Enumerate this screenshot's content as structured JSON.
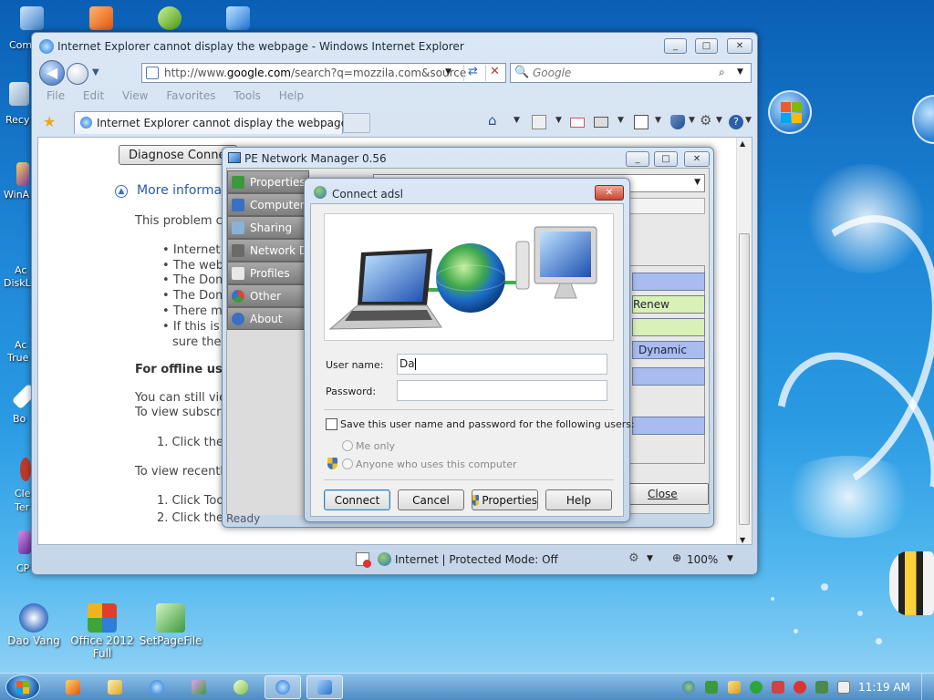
{
  "desktop": {
    "icons_bottom": [
      {
        "label": "Dao Vang"
      },
      {
        "label": "Office 2012 Full"
      },
      {
        "label": "SetPageFile"
      }
    ],
    "edge_labels": [
      "Com",
      "Recy",
      "WinA",
      "Ac",
      "DiskL",
      "Ac",
      "True",
      "Bo",
      "Cle",
      "Ter",
      "CP"
    ]
  },
  "ie": {
    "title": "Internet Explorer cannot display the webpage - Windows Internet Explorer",
    "address_prefix": "http://www.",
    "address_domain": "google.com",
    "address_rest": "/search?q=mozzila.com&source",
    "search_placeholder": "Google",
    "menu": [
      "File",
      "Edit",
      "View",
      "Favorites",
      "Tools",
      "Help"
    ],
    "tab_title": "Internet Explorer cannot display the webpage",
    "content": {
      "diagnose_button": "Diagnose Connec",
      "more_info": "More informati",
      "problem": "This problem ca",
      "bullets": [
        "Internet c",
        "The webs",
        "The Doma",
        "The Doma",
        "There mig",
        "If this is a",
        "sure the S"
      ],
      "offline_heading": "For offline user",
      "offline_text_1": "You can still view",
      "offline_text_2": "To view subscrib",
      "step1_a": "1.  Click the F",
      "recent": "To view recently",
      "step1_b": "1.  Click Tool",
      "step2_b": "2.  Click the F"
    },
    "status": {
      "zone": "Internet | Protected Mode: Off",
      "zoom": "100%"
    }
  },
  "pe": {
    "title": "PE Network Manager 0.56",
    "sidebar": [
      {
        "label": "Properties",
        "icon": "properties-icon",
        "color": "#3a9a3a"
      },
      {
        "label": "Computer",
        "icon": "computer-icon",
        "color": "#3a6fc4"
      },
      {
        "label": "Sharing",
        "icon": "sharing-icon",
        "color": "#8ab2d8"
      },
      {
        "label": "Network Driv",
        "icon": "network-drive-icon",
        "color": "#6a6a6a"
      },
      {
        "label": "Profiles",
        "icon": "profiles-icon",
        "color": "#e8e8e8"
      },
      {
        "label": "Other",
        "icon": "other-icon",
        "color": "#d24a3a"
      },
      {
        "label": "About",
        "icon": "help-icon",
        "color": "#3a6fc4"
      }
    ],
    "buttons": {
      "renew": "Renew",
      "dynamic": "Dynamic",
      "close": "Close"
    },
    "status": "Ready"
  },
  "dialog": {
    "title": "Connect adsl",
    "username_label": "User name:",
    "username_value": "Da",
    "password_label": "Password:",
    "save_label": "Save this user name and password for the following users:",
    "me_only": "Me only",
    "anyone": "Anyone who uses this computer",
    "buttons": {
      "connect": "Connect",
      "cancel": "Cancel",
      "properties": "Properties",
      "help": "Help"
    }
  },
  "taskbar": {
    "clock": "11:19 AM"
  },
  "colors": {
    "accent": "#3c7fb1",
    "pe_bar_blue": "#a9bcf0",
    "pe_bar_green": "#d9f0b6"
  }
}
